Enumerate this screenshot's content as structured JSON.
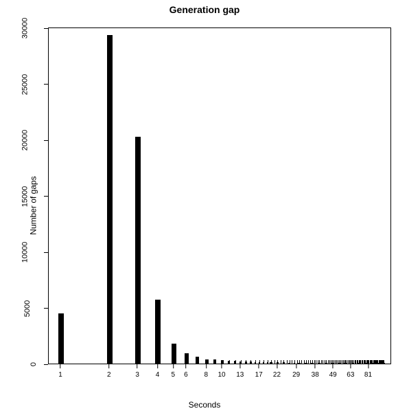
{
  "chart_data": {
    "type": "bar",
    "title": "Generation gap",
    "xlabel": "Seconds",
    "ylabel": "Number of gaps",
    "ylim": [
      0,
      30000
    ],
    "x_log_range": [
      1,
      100
    ],
    "y_ticks": [
      0,
      5000,
      10000,
      15000,
      20000,
      25000,
      30000
    ],
    "x_tick_labels": [
      "1",
      "2",
      "3",
      "4",
      "5",
      "6",
      "8",
      "10",
      "13",
      "17",
      "22",
      "29",
      "38",
      "49",
      "63",
      "81"
    ],
    "x_tick_values": [
      1,
      2,
      3,
      4,
      5,
      6,
      8,
      10,
      13,
      17,
      22,
      29,
      38,
      49,
      63,
      81
    ],
    "categories": [
      1,
      2,
      3,
      4,
      5,
      6,
      7,
      8,
      9,
      10,
      11,
      12,
      13,
      14,
      15,
      16,
      17,
      18,
      19,
      20,
      22,
      24,
      26,
      28,
      30,
      33,
      36,
      40,
      44,
      48,
      53,
      58,
      64,
      70,
      77,
      85,
      93,
      100
    ],
    "values": [
      4500,
      29400,
      20300,
      5700,
      1800,
      900,
      600,
      400,
      350,
      300,
      250,
      220,
      200,
      180,
      160,
      150,
      140,
      130,
      120,
      110,
      100,
      95,
      90,
      85,
      80,
      75,
      70,
      65,
      60,
      58,
      55,
      52,
      50,
      48,
      46,
      44,
      42,
      40
    ]
  }
}
